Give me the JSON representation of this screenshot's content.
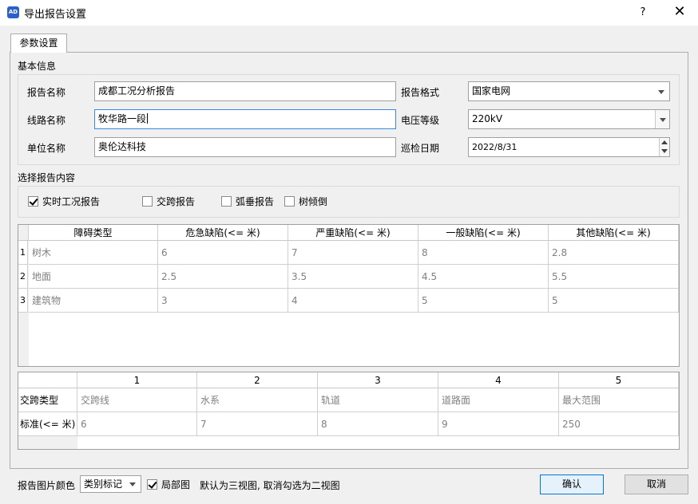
{
  "window": {
    "title": "导出报告设置",
    "icon_text": "AD",
    "help_label": "?",
    "close_label": "✕"
  },
  "tab": {
    "label": "参数设置"
  },
  "basic_info": {
    "section_title": "基本信息",
    "report_name_label": "报告名称",
    "report_name_value": "成都工况分析报告",
    "line_name_label": "线路名称",
    "line_name_value": "牧华路一段",
    "unit_name_label": "单位名称",
    "unit_name_value": "奥伦达科技",
    "report_format_label": "报告格式",
    "report_format_value": "国家电网",
    "voltage_label": "电压等级",
    "voltage_value": "220kV",
    "date_label": "巡检日期",
    "date_value": "2022/8/31"
  },
  "content": {
    "section_title": "选择报告内容",
    "options": [
      {
        "label": "实时工况报告",
        "checked": true
      },
      {
        "label": "交跨报告",
        "checked": false
      },
      {
        "label": "弧垂报告",
        "checked": false
      },
      {
        "label": "树倾倒",
        "checked": false
      }
    ]
  },
  "obstacle_table": {
    "headers": [
      "障碍类型",
      "危急缺陷(<= 米)",
      "严重缺陷(<= 米)",
      "一般缺陷(<= 米)",
      "其他缺陷(<= 米)"
    ],
    "rows": [
      {
        "num": "1",
        "cells": [
          "树木",
          "6",
          "7",
          "8",
          "2.8"
        ]
      },
      {
        "num": "2",
        "cells": [
          "地面",
          "2.5",
          "3.5",
          "4.5",
          "5.5"
        ]
      },
      {
        "num": "3",
        "cells": [
          "建筑物",
          "3",
          "4",
          "5",
          "5"
        ]
      }
    ]
  },
  "crossing_table": {
    "headers": [
      "1",
      "2",
      "3",
      "4",
      "5"
    ],
    "rows": [
      {
        "label": "交跨类型",
        "cells": [
          "交跨线",
          "水系",
          "轨道",
          "道路面",
          "最大范围"
        ]
      },
      {
        "label": "标准(<= 米)",
        "cells": [
          "6",
          "7",
          "8",
          "9",
          "250"
        ]
      }
    ]
  },
  "footer": {
    "image_color_label": "报告图片颜色",
    "image_color_value": "类别标记",
    "partial_label": "局部图",
    "partial_checked": true,
    "hint": "默认为三视图, 取消勾选为二视图",
    "confirm_label": "确认",
    "cancel_label": "取消"
  },
  "colors": {
    "accent": "#0078d7",
    "focus_border": "#3a8be0",
    "icon_bg": "#2a62c9"
  }
}
